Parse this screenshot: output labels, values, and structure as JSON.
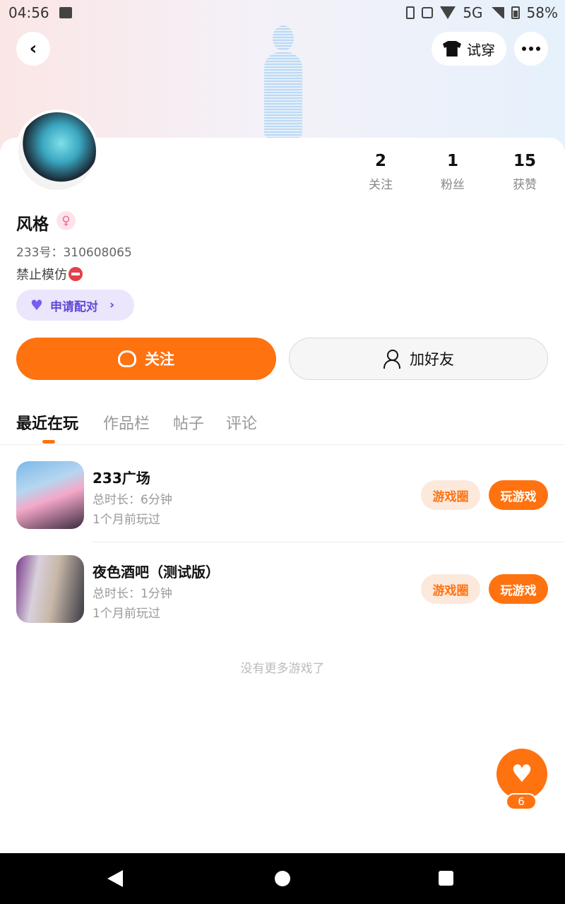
{
  "status_bar": {
    "time": "04:56",
    "network": "5G",
    "battery": "58%"
  },
  "header": {
    "try_on_label": "试穿"
  },
  "profile": {
    "name": "风格",
    "gender_symbol": "♀",
    "uid": "233号：310608065",
    "bio": "禁止模仿",
    "pair_label": "申请配对",
    "stats": [
      {
        "value": "2",
        "label": "关注"
      },
      {
        "value": "1",
        "label": "粉丝"
      },
      {
        "value": "15",
        "label": "获赞"
      }
    ]
  },
  "actions": {
    "follow_label": "关注",
    "add_friend_label": "加好友"
  },
  "tabs": [
    "最近在玩",
    "作品栏",
    "帖子",
    "评论"
  ],
  "games": [
    {
      "title": "233广场",
      "duration": "总时长：6分钟",
      "last_played": "1个月前玩过",
      "circle_label": "游戏圈",
      "play_label": "玩游戏"
    },
    {
      "title": "夜色酒吧（测试版）",
      "duration": "总时长：1分钟",
      "last_played": "1个月前玩过",
      "circle_label": "游戏圈",
      "play_label": "玩游戏"
    }
  ],
  "no_more_text": "没有更多游戏了",
  "like_fab": {
    "count": "6"
  },
  "colors": {
    "accent": "#ff7210",
    "pair_bg": "#ebe6fc",
    "pair_text": "#6149d6"
  }
}
